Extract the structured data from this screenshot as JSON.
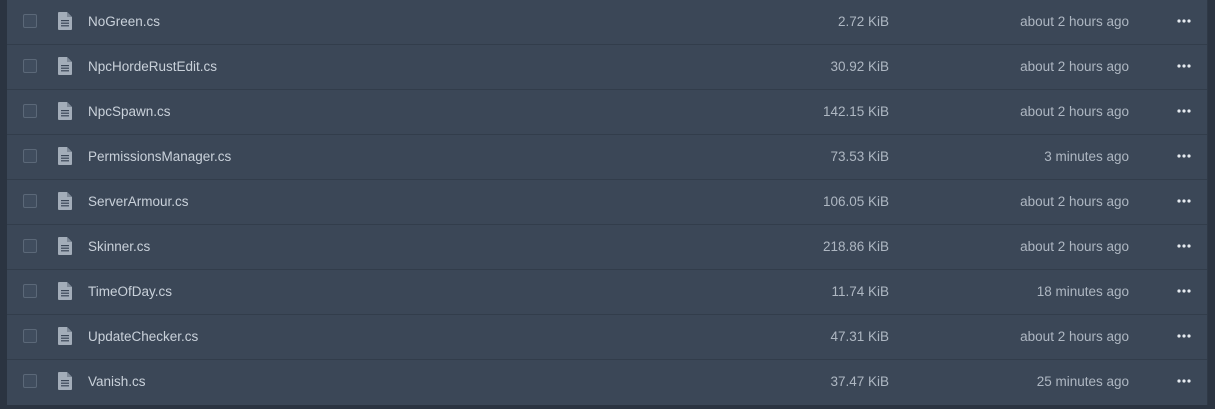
{
  "files": [
    {
      "name": "NoGreen.cs",
      "size": "2.72 KiB",
      "modified": "about 2 hours ago",
      "icon": "file-icon",
      "menu_icon": "more-icon"
    },
    {
      "name": "NpcHordeRustEdit.cs",
      "size": "30.92 KiB",
      "modified": "about 2 hours ago",
      "icon": "file-icon",
      "menu_icon": "more-icon"
    },
    {
      "name": "NpcSpawn.cs",
      "size": "142.15 KiB",
      "modified": "about 2 hours ago",
      "icon": "file-icon",
      "menu_icon": "more-icon"
    },
    {
      "name": "PermissionsManager.cs",
      "size": "73.53 KiB",
      "modified": "3 minutes ago",
      "icon": "file-icon",
      "menu_icon": "more-icon"
    },
    {
      "name": "ServerArmour.cs",
      "size": "106.05 KiB",
      "modified": "about 2 hours ago",
      "icon": "file-icon",
      "menu_icon": "more-icon"
    },
    {
      "name": "Skinner.cs",
      "size": "218.86 KiB",
      "modified": "about 2 hours ago",
      "icon": "file-icon",
      "menu_icon": "more-icon"
    },
    {
      "name": "TimeOfDay.cs",
      "size": "11.74 KiB",
      "modified": "18 minutes ago",
      "icon": "file-icon",
      "menu_icon": "more-icon"
    },
    {
      "name": "UpdateChecker.cs",
      "size": "47.31 KiB",
      "modified": "about 2 hours ago",
      "icon": "file-icon",
      "menu_icon": "more-icon"
    },
    {
      "name": "Vanish.cs",
      "size": "37.47 KiB",
      "modified": "25 minutes ago",
      "icon": "file-icon",
      "menu_icon": "more-icon"
    }
  ],
  "colors": {
    "background": "#2b3441",
    "row_background": "#3b4757",
    "row_divider": "#323d4b",
    "text_primary": "#c9d1da",
    "text_secondary": "#aeb7c2",
    "icon": "#a3adb9"
  }
}
